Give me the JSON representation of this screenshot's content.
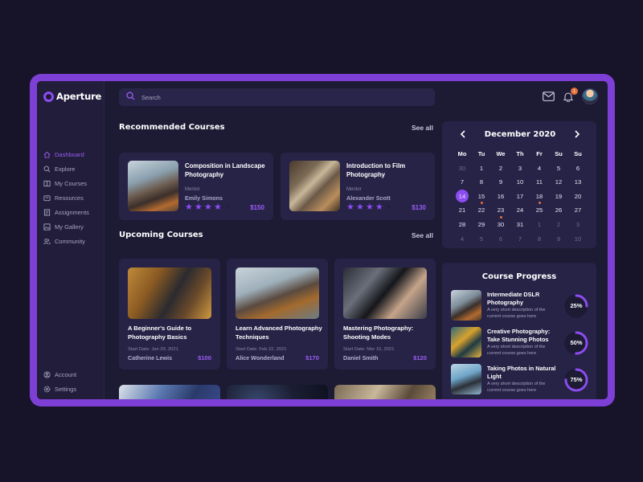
{
  "brand": {
    "name": "Aperture"
  },
  "colors": {
    "accent": "#8b4cf0",
    "frame": "#7d3fd6",
    "dot": "#e2703a",
    "panel": "#272347"
  },
  "sidebar": {
    "items": [
      {
        "label": "Dashboard",
        "icon": "home-icon",
        "active": true
      },
      {
        "label": "Explore",
        "icon": "explore-icon"
      },
      {
        "label": "My Courses",
        "icon": "book-icon"
      },
      {
        "label": "Resources",
        "icon": "resources-icon"
      },
      {
        "label": "Assignments",
        "icon": "assignment-icon"
      },
      {
        "label": "My Gallery",
        "icon": "gallery-icon"
      },
      {
        "label": "Community",
        "icon": "community-icon"
      }
    ],
    "bottom": [
      {
        "label": "Account",
        "icon": "account-icon"
      },
      {
        "label": "Settings",
        "icon": "settings-icon"
      }
    ]
  },
  "header": {
    "search_placeholder": "Search",
    "notification_count": "1"
  },
  "recommended": {
    "title": "Recommended Courses",
    "see_all": "See all",
    "mentor_label": "Mentor",
    "cards": [
      {
        "title": "Composition in Landscape Photography",
        "mentor": "Emily Simons",
        "rating": 4,
        "price": "$150"
      },
      {
        "title": "Introduction to Film Photography",
        "mentor": "Alexander Scott",
        "rating": 4,
        "price": "$130"
      }
    ]
  },
  "upcoming": {
    "title": "Upcoming Courses",
    "see_all": "See all",
    "cards": [
      {
        "title": "A Beginner's Guide to Photography Basics",
        "date": "Start Date: Jan 20, 2021",
        "mentor": "Catherine Lewis",
        "price": "$100"
      },
      {
        "title": "Learn Advanced Photography Techniques",
        "date": "Start Date: Feb 22, 2021",
        "mentor": "Alice Wonderland",
        "price": "$170"
      },
      {
        "title": "Mastering Photography: Shooting Modes",
        "date": "Start Date: Mar 15, 2021",
        "mentor": "Daniel Smith",
        "price": "$120"
      }
    ]
  },
  "calendar": {
    "month": "December 2020",
    "weekdays": [
      "Mo",
      "Tu",
      "We",
      "Th",
      "Fr",
      "Su",
      "Su"
    ],
    "days": [
      {
        "d": "30",
        "m": true
      },
      {
        "d": "1"
      },
      {
        "d": "2"
      },
      {
        "d": "3"
      },
      {
        "d": "4"
      },
      {
        "d": "5"
      },
      {
        "d": "6"
      },
      {
        "d": "7"
      },
      {
        "d": "8"
      },
      {
        "d": "9"
      },
      {
        "d": "10"
      },
      {
        "d": "11"
      },
      {
        "d": "12"
      },
      {
        "d": "13"
      },
      {
        "d": "14",
        "sel": true
      },
      {
        "d": "15",
        "dot": true
      },
      {
        "d": "16"
      },
      {
        "d": "17"
      },
      {
        "d": "18",
        "dot": true
      },
      {
        "d": "19"
      },
      {
        "d": "20"
      },
      {
        "d": "21"
      },
      {
        "d": "22"
      },
      {
        "d": "23",
        "dot": true
      },
      {
        "d": "24"
      },
      {
        "d": "25"
      },
      {
        "d": "26"
      },
      {
        "d": "27"
      },
      {
        "d": "28"
      },
      {
        "d": "29"
      },
      {
        "d": "30"
      },
      {
        "d": "31"
      },
      {
        "d": "1",
        "m": true
      },
      {
        "d": "2",
        "m": true
      },
      {
        "d": "3",
        "m": true
      },
      {
        "d": "4",
        "m": true
      },
      {
        "d": "5",
        "m": true
      },
      {
        "d": "6",
        "m": true
      },
      {
        "d": "7",
        "m": true
      },
      {
        "d": "8",
        "m": true
      },
      {
        "d": "9",
        "m": true
      },
      {
        "d": "10",
        "m": true
      }
    ]
  },
  "progress": {
    "title": "Course Progress",
    "items": [
      {
        "name": "Intermediate DSLR Photography",
        "desc": "A very short description of the current course goes here",
        "pct": 25,
        "pct_label": "25%"
      },
      {
        "name": "Creative Photography: Take Stunning Photos",
        "desc": "A very short description of the current course goes here",
        "pct": 50,
        "pct_label": "50%"
      },
      {
        "name": "Taking Photos in Natural Light",
        "desc": "A very short description of the current course goes here",
        "pct": 75,
        "pct_label": "75%"
      }
    ]
  }
}
